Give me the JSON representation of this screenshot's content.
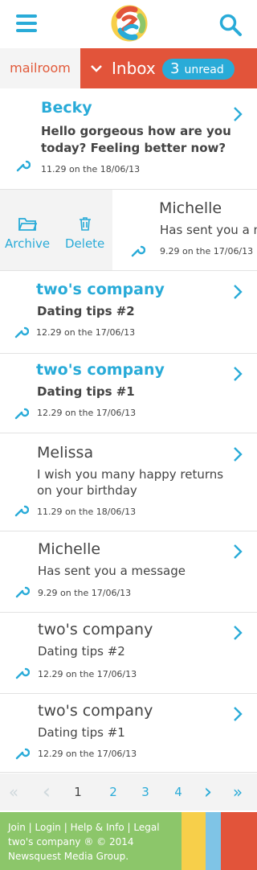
{
  "header": {
    "menu_icon": "hamburger-icon",
    "logo_icon": "twos-company-logo",
    "search_icon": "search-icon"
  },
  "nav": {
    "mailroom_label": "mailroom",
    "inbox_label": "Inbox",
    "unread_count": "3",
    "unread_label": "unread"
  },
  "messages": [
    {
      "sender": "Becky",
      "subject_line1": "Hello gorgeous how are you",
      "subject_line2": "today? Feeling better now?",
      "time": "11.29 on the 18/06/13"
    },
    {
      "sender": "Michelle",
      "subject_line1": "Has sent you a message",
      "time": "9.29 on the 17/06/13"
    },
    {
      "sender": "two's company",
      "subject_line1": "Dating tips #2",
      "time": "12.29 on the 17/06/13"
    },
    {
      "sender": "two's company",
      "subject_line1": "Dating tips #1",
      "time": "12.29 on the 17/06/13"
    },
    {
      "sender": "Melissa",
      "subject_line1": "I wish you many happy returns",
      "subject_line2": "on your birthday",
      "time": "11.29 on the 18/06/13"
    },
    {
      "sender": "Michelle",
      "subject_line1": "Has sent you a message",
      "time": "9.29 on the 17/06/13"
    },
    {
      "sender": "two's company",
      "subject_line1": "Dating tips #2",
      "time": "12.29 on the 17/06/13"
    },
    {
      "sender": "two's company",
      "subject_line1": "Dating tips #1",
      "time": "12.29 on the 17/06/13"
    }
  ],
  "swipe_actions": {
    "archive_label": "Archive",
    "delete_label": "Delete"
  },
  "pagination": {
    "first": "«",
    "prev": "‹",
    "pages": [
      "1",
      "2",
      "3",
      "4"
    ],
    "current": "1",
    "next": "›",
    "last": "»"
  },
  "footer": {
    "join": "Join",
    "login": "Login",
    "help": "Help & Info",
    "legal": "Legal",
    "sep": "|",
    "copyright_line1": "two's company ® © 2014",
    "copyright_line2": "Newsquest Media Group."
  },
  "colors": {
    "accent_blue": "#29abd8",
    "inbox_red": "#e2543a",
    "footer_green": "#8cc66a",
    "stripe_yellow": "#f7cf4a",
    "stripe_blue": "#7fc4e6",
    "stripe_red": "#e2543a"
  }
}
